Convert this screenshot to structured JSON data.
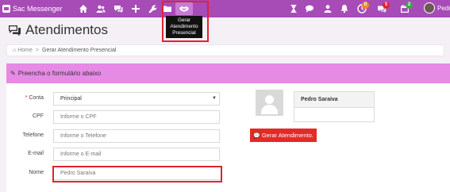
{
  "colors": {
    "topbar": "#a74bb7",
    "panel_header": "#e78ae6",
    "highlight": "#e0242e",
    "primary_button": "#e22b27"
  },
  "topbar": {
    "brand": "Sac Messenger",
    "nav_icons": [
      "home-icon",
      "users-icon",
      "chat-icon",
      "plus-icon",
      "wrench-icon",
      "folder-icon",
      "handshake-icon"
    ],
    "tooltip": "Gerar Atendimento Presencial",
    "right_icons": [
      "hourglass-icon",
      "chat-bubble-icon",
      "person-icon",
      "bell-icon",
      "clock-icon",
      "comments-icon",
      "calendar-icon"
    ],
    "badges": {
      "clock": "0",
      "comments": "5",
      "calendar": "2"
    },
    "user_name": "Pedr"
  },
  "page": {
    "title": "Atendimentos"
  },
  "breadcrumb": {
    "home": "Home",
    "current": "Gerar Atendimento Presencial"
  },
  "form": {
    "header": "Preencha o formulário abaixo",
    "conta_label": "Conta",
    "conta_value": "Principal",
    "cpf_label": "CPF",
    "cpf_placeholder": "Informe o CPF",
    "telefone_label": "Telefone",
    "telefone_placeholder": "Informe o Telefone",
    "email_label": "E-mail",
    "email_placeholder": "Informe o E-mail",
    "nome_label": "Nome",
    "nome_value": "Pedro Saraiva"
  },
  "client_card": {
    "name": "Pedro Saraiva"
  },
  "actions": {
    "gerar": "Gerar Atendimento."
  }
}
